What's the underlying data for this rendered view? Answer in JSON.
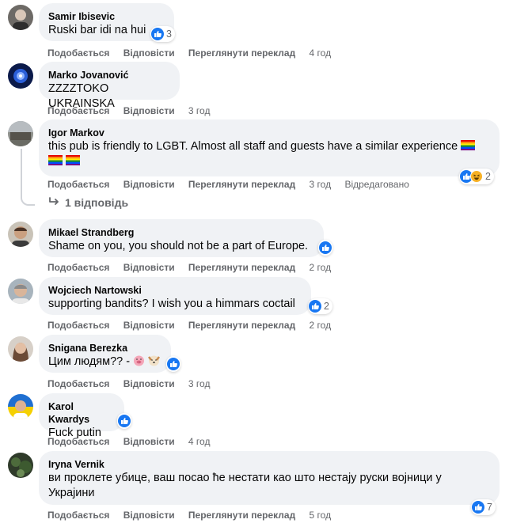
{
  "labels": {
    "like": "Подобається",
    "reply": "Відповісти",
    "translate": "Переглянути переклад",
    "edited": "Відредаговано",
    "replies": "1 відповідь"
  },
  "comments": [
    {
      "author": "Samir Ibisevic",
      "text": "Ruski bar idi na hui",
      "time": "4 год",
      "reactions": "3"
    },
    {
      "author": "Marko Jovanović",
      "text": "ZZZZTOKO UKRAINSKA",
      "time": "3 год"
    },
    {
      "author": "Igor Markov",
      "text": "this pub is friendly to LGBT. Almost all staff and guests have a similar experience",
      "time": "3 год",
      "reactions": "2"
    },
    {
      "author": "Mikael Strandberg",
      "text": "Shame on you, you should not be a part of Europe.",
      "time": "2 год"
    },
    {
      "author": "Wojciech Nartowski",
      "text": "supporting bandits? I wish you a himmars coctail",
      "time": "2 год",
      "reactions": "2"
    },
    {
      "author": "Snigana Berezka",
      "text": "Цим людям?? -",
      "time": "3 год"
    },
    {
      "author": "Karol Kwardys",
      "text": "Fuck putin",
      "time": "4 год"
    },
    {
      "author": "Iryna Vernik",
      "text": "ви проклете убице, ваш посао ће нестати као што нестају руски војници у",
      "text2": "Украјини",
      "time": "5 год",
      "reactions": "7"
    }
  ],
  "colors": {
    "accent": "#1877f2",
    "bubble": "#f0f2f5",
    "meta": "#65676b"
  }
}
